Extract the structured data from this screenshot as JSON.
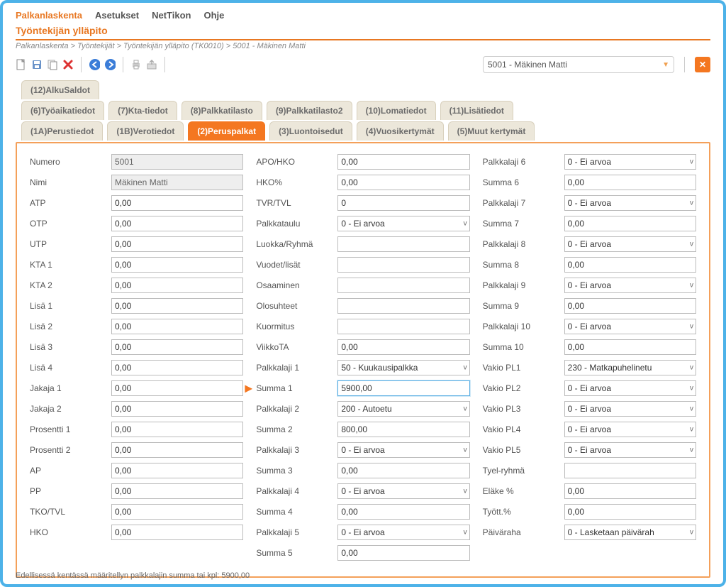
{
  "menubar": {
    "items": [
      "Palkanlaskenta",
      "Asetukset",
      "NetTikon",
      "Ohje"
    ],
    "active": 0
  },
  "page_title": "Työntekijän ylläpito",
  "breadcrumb": "Palkanlaskenta > Työntekijät > Työntekijän ylläpito  (TK0010) > 5001 - Mäkinen Matti",
  "employee_select": "5001 - Mäkinen Matti",
  "tabs": {
    "row0": [
      "(12)AlkuSaldot"
    ],
    "row1": [
      "(6)Työaikatiedot",
      "(7)Kta-tiedot",
      "(8)Palkkatilasto",
      "(9)Palkkatilasto2",
      "(10)Lomatiedot",
      "(11)Lisätiedot"
    ],
    "row2": [
      "(1A)Perustiedot",
      "(1B)Verotiedot",
      "(2)Peruspalkat",
      "(3)Luontoisedut",
      "(4)Vuosikertymät",
      "(5)Muut kertymät"
    ],
    "active": "(2)Peruspalkat"
  },
  "col1": [
    {
      "label": "Numero",
      "value": "5001",
      "readonly": true
    },
    {
      "label": "Nimi",
      "value": "Mäkinen Matti",
      "readonly": true
    },
    {
      "label": "ATP",
      "value": "0,00"
    },
    {
      "label": "OTP",
      "value": "0,00"
    },
    {
      "label": "UTP",
      "value": "0,00"
    },
    {
      "label": "KTA 1",
      "value": "0,00"
    },
    {
      "label": "KTA 2",
      "value": "0,00"
    },
    {
      "label": "Lisä 1",
      "value": "0,00"
    },
    {
      "label": "Lisä 2",
      "value": "0,00"
    },
    {
      "label": "Lisä 3",
      "value": "0,00"
    },
    {
      "label": "Lisä 4",
      "value": "0,00"
    },
    {
      "label": "Jakaja 1",
      "value": "0,00"
    },
    {
      "label": "Jakaja 2",
      "value": "0,00"
    },
    {
      "label": "Prosentti 1",
      "value": "0,00"
    },
    {
      "label": "Prosentti 2",
      "value": "0,00"
    },
    {
      "label": "AP",
      "value": "0,00"
    },
    {
      "label": "PP",
      "value": "0,00"
    },
    {
      "label": "TKO/TVL",
      "value": "0,00"
    },
    {
      "label": "HKO",
      "value": "0,00"
    }
  ],
  "col2": [
    {
      "label": "APO/HKO",
      "value": "0,00"
    },
    {
      "label": "HKO%",
      "value": "0,00"
    },
    {
      "label": "TVR/TVL",
      "value": "0"
    },
    {
      "label": "Palkkataulu",
      "value": "0 - Ei arvoa",
      "select": true
    },
    {
      "label": "Luokka/Ryhmä",
      "value": ""
    },
    {
      "label": "Vuodet/lisät",
      "value": ""
    },
    {
      "label": "Osaaminen",
      "value": ""
    },
    {
      "label": "Olosuhteet",
      "value": ""
    },
    {
      "label": "Kuormitus",
      "value": ""
    },
    {
      "label": "ViikkoTA",
      "value": "0,00"
    },
    {
      "label": "Palkkalaji 1",
      "value": "50 - Kuukausipalkka",
      "select": true
    },
    {
      "label": "Summa 1",
      "value": "5900,00",
      "focused": true,
      "indicator": true
    },
    {
      "label": "Palkkalaji 2",
      "value": "200 - Autoetu",
      "select": true
    },
    {
      "label": "Summa 2",
      "value": "800,00"
    },
    {
      "label": "Palkkalaji 3",
      "value": "0 - Ei arvoa",
      "select": true
    },
    {
      "label": "Summa 3",
      "value": "0,00"
    },
    {
      "label": "Palkkalaji 4",
      "value": "0 - Ei arvoa",
      "select": true
    },
    {
      "label": "Summa 4",
      "value": "0,00"
    },
    {
      "label": "Palkkalaji 5",
      "value": "0 - Ei arvoa",
      "select": true
    },
    {
      "label": "Summa 5",
      "value": "0,00"
    }
  ],
  "col3": [
    {
      "label": "Palkkalaji 6",
      "value": "0 - Ei arvoa",
      "select": true
    },
    {
      "label": "Summa 6",
      "value": "0,00"
    },
    {
      "label": "Palkkalaji 7",
      "value": "0 - Ei arvoa",
      "select": true
    },
    {
      "label": "Summa 7",
      "value": "0,00"
    },
    {
      "label": "Palkkalaji 8",
      "value": "0 - Ei arvoa",
      "select": true
    },
    {
      "label": "Summa 8",
      "value": "0,00"
    },
    {
      "label": "Palkkalaji 9",
      "value": "0 - Ei arvoa",
      "select": true
    },
    {
      "label": "Summa 9",
      "value": "0,00"
    },
    {
      "label": "Palkkalaji 10",
      "value": "0 - Ei arvoa",
      "select": true
    },
    {
      "label": "Summa 10",
      "value": "0,00"
    },
    {
      "label": "Vakio PL1",
      "value": "230 - Matkapuhelinetu",
      "select": true
    },
    {
      "label": "Vakio PL2",
      "value": "0 - Ei arvoa",
      "select": true
    },
    {
      "label": "Vakio PL3",
      "value": "0 - Ei arvoa",
      "select": true
    },
    {
      "label": "Vakio PL4",
      "value": "0 - Ei arvoa",
      "select": true
    },
    {
      "label": "Vakio PL5",
      "value": "0 - Ei arvoa",
      "select": true
    },
    {
      "label": "Tyel-ryhmä",
      "value": ""
    },
    {
      "label": "Eläke %",
      "value": "0,00"
    },
    {
      "label": "Tyött.%",
      "value": "0,00"
    },
    {
      "label": "Päiväraha",
      "value": "0 - Lasketaan päivärah",
      "select": true
    }
  ],
  "statusbar": "Edellisessä kentässä määritellyn palkkalajin summa tai kpl: 5900,00"
}
